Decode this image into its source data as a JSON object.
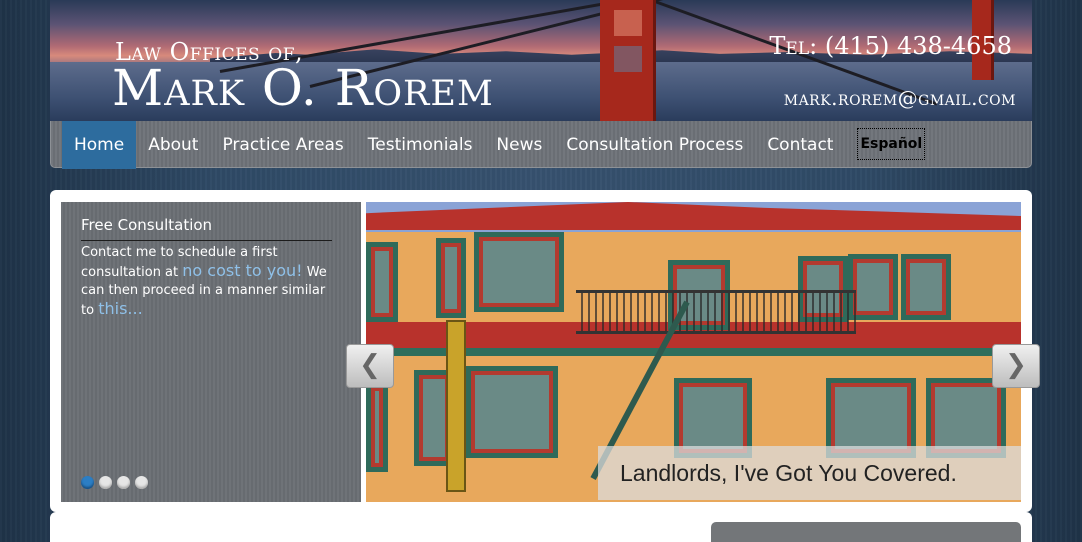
{
  "header": {
    "logo_line1": "Law Offices of,",
    "logo_line2": "Mark O. Rorem",
    "phone": "Tel: (415) 438-4658",
    "email": "mark.rorem@gmail.com"
  },
  "nav": {
    "items": [
      {
        "label": "Home",
        "active": true
      },
      {
        "label": "About"
      },
      {
        "label": "Practice Areas"
      },
      {
        "label": "Testimonials"
      },
      {
        "label": "News"
      },
      {
        "label": "Consultation Process"
      },
      {
        "label": "Contact"
      }
    ],
    "language": "Español"
  },
  "slider": {
    "caption_title": "Free Consultation",
    "caption_text_1": "Contact me to schedule a first consultation at",
    "caption_highlight_1": "no cost to you!",
    "caption_text_2": "We can then proceed in a manner similar to",
    "caption_highlight_2": "this...",
    "slogan": "Landlords, I've Got You Covered.",
    "prev_icon": "chevron-left-icon",
    "next_icon": "chevron-right-icon",
    "prev_glyph": "❮",
    "next_glyph": "❯",
    "dots_total": 4,
    "dots_active": 1
  },
  "colors": {
    "nav_active": "#2d6c9e",
    "highlight": "#8fc0e8"
  }
}
